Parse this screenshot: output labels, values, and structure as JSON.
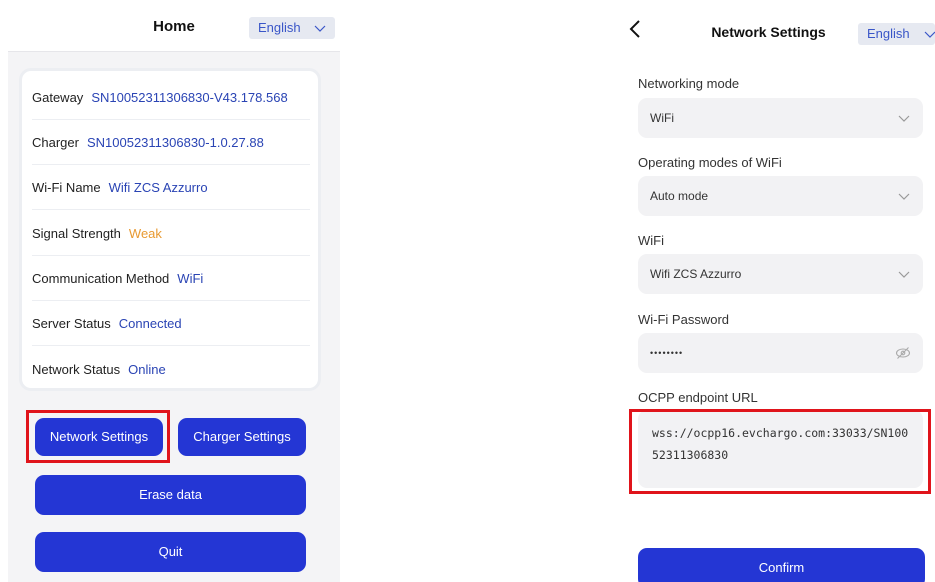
{
  "home": {
    "title": "Home",
    "language": "English",
    "rows": [
      {
        "label": "Gateway",
        "value": "SN10052311306830-V43.178.568",
        "style": "normal"
      },
      {
        "label": "Charger",
        "value": "SN10052311306830-1.0.27.88",
        "style": "normal"
      },
      {
        "label": "Wi-Fi Name",
        "value": "Wifi ZCS Azzurro",
        "style": "normal"
      },
      {
        "label": "Signal Strength",
        "value": "Weak",
        "style": "weak"
      },
      {
        "label": "Communication Method",
        "value": "WiFi",
        "style": "normal"
      },
      {
        "label": "Server Status",
        "value": "Connected",
        "style": "normal"
      },
      {
        "label": "Network Status",
        "value": "Online",
        "style": "normal"
      }
    ],
    "buttons": {
      "network_settings": "Network Settings",
      "charger_settings": "Charger Settings",
      "erase_data": "Erase data",
      "quit": "Quit"
    }
  },
  "network": {
    "title": "Network Settings",
    "language": "English",
    "networking_mode_label": "Networking mode",
    "networking_mode_value": "WiFi",
    "wifi_mode_label": "Operating modes of WiFi",
    "wifi_mode_value": "Auto mode",
    "wifi_label": "WiFi",
    "wifi_value": "Wifi ZCS Azzurro",
    "password_label": "Wi-Fi Password",
    "password_value": "••••••••",
    "ocpp_label": "OCPP endpoint URL",
    "ocpp_value": "wss://ocpp16.evchargo.com:33033/SN10052311306830",
    "confirm": "Confirm"
  },
  "colors": {
    "accent": "#2436d4",
    "value_text": "#2a44b4",
    "weak": "#e89a32",
    "highlight": "#e0141b"
  }
}
